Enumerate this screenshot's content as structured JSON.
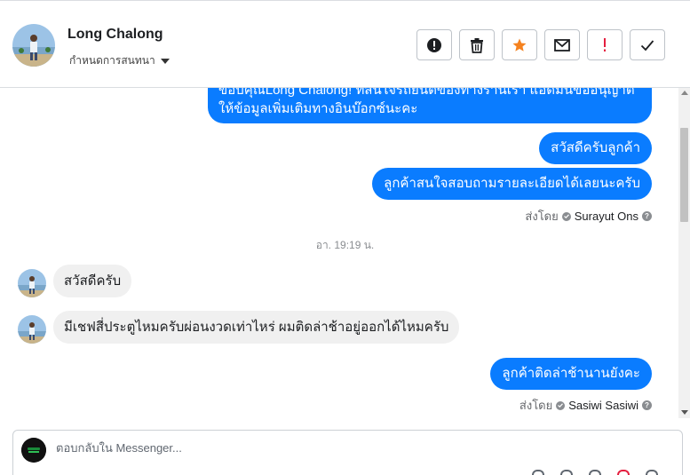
{
  "header": {
    "contact_name": "Long Chalong",
    "conversation_label": "กำหนดการสนทนา",
    "actions": [
      {
        "name": "report-spam",
        "icon": "exclamation-circle-icon"
      },
      {
        "name": "delete",
        "icon": "trash-icon"
      },
      {
        "name": "star",
        "icon": "star-icon"
      },
      {
        "name": "mark-unread",
        "icon": "envelope-icon"
      },
      {
        "name": "mark-important",
        "icon": "exclamation-icon"
      },
      {
        "name": "mark-done",
        "icon": "checkmark-icon"
      }
    ]
  },
  "messages": {
    "out_thanks": "ขอบคุณLong Chalong! ที่สนใจรถยนต์ของทางร้านเรา แอดมินขออนุญาติให้ข้อมูลเพิ่มเติมทางอินบ๊อกซ์นะคะ",
    "out_hello": "สวัสดีครับลูกค้า",
    "out_ask": "ลูกค้าสนใจสอบถามรายละเอียดได้เลยนะครับ",
    "sent_by_label": "ส่งโดย",
    "sender_1": "Surayut Ons",
    "timestamp": "อา. 19:19 น.",
    "in_hello": "สวัสดีครับ",
    "in_question": "มีเชฟสี่ประตูไหมครับผ่อนงวดเท่าไหร่ ผมติดล่าช้าอยู่ออกได้ไหมครับ",
    "out_late": "ลูกค้าติดล่าช้านานยังคะ",
    "sender_2": "Sasiwi Sasiwi"
  },
  "reply": {
    "placeholder": "ตอบกลับใน Messenger..."
  },
  "colors": {
    "outgoing_bubble": "#0a7cff",
    "incoming_bubble": "#f0f0f0",
    "star": "#f5821f",
    "important": "#e41e3f"
  }
}
